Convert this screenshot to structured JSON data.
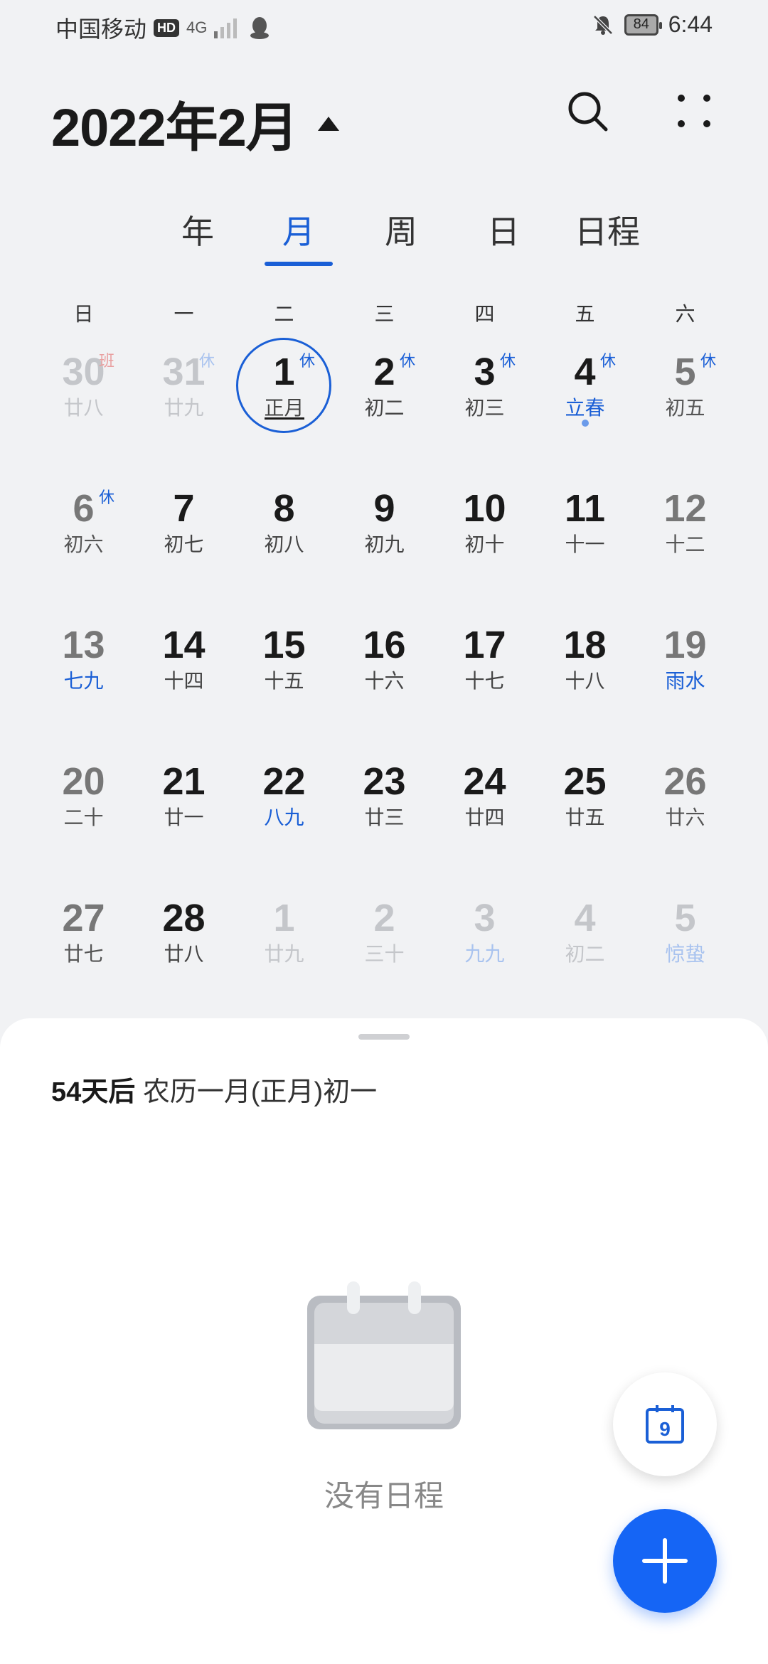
{
  "status_bar": {
    "carrier": "中国移动",
    "hd_badge": "HD",
    "network": "4G",
    "battery_level": "84",
    "time": "6:44"
  },
  "header": {
    "title": "2022年2月",
    "caret_icon": "triangle-up-icon",
    "search_icon": "search-icon",
    "more_icon": "more-dots-icon"
  },
  "tabs": [
    {
      "label": "年"
    },
    {
      "label": "月"
    },
    {
      "label": "周"
    },
    {
      "label": "日"
    },
    {
      "label": "日程"
    }
  ],
  "active_tab": "月",
  "weekdays": [
    "日",
    "一",
    "二",
    "三",
    "四",
    "五",
    "六"
  ],
  "weeks": [
    [
      {
        "day": "30",
        "lunar": "廿八",
        "badge": "班",
        "outside": true
      },
      {
        "day": "31",
        "lunar": "廿九",
        "badge": "休",
        "outside": true
      },
      {
        "day": "1",
        "lunar": "正月",
        "badge": "休",
        "today": true
      },
      {
        "day": "2",
        "lunar": "初二",
        "badge": "休"
      },
      {
        "day": "3",
        "lunar": "初三",
        "badge": "休"
      },
      {
        "day": "4",
        "lunar": "立春",
        "badge": "休",
        "lunar_blue": true,
        "dot": true
      },
      {
        "day": "5",
        "lunar": "初五",
        "badge": "休",
        "weekend": true
      }
    ],
    [
      {
        "day": "6",
        "lunar": "初六",
        "badge": "休",
        "weekend": true
      },
      {
        "day": "7",
        "lunar": "初七"
      },
      {
        "day": "8",
        "lunar": "初八"
      },
      {
        "day": "9",
        "lunar": "初九"
      },
      {
        "day": "10",
        "lunar": "初十"
      },
      {
        "day": "11",
        "lunar": "十一"
      },
      {
        "day": "12",
        "lunar": "十二",
        "weekend": true
      }
    ],
    [
      {
        "day": "13",
        "lunar": "七九",
        "lunar_blue": true,
        "weekend": true
      },
      {
        "day": "14",
        "lunar": "十四"
      },
      {
        "day": "15",
        "lunar": "十五"
      },
      {
        "day": "16",
        "lunar": "十六"
      },
      {
        "day": "17",
        "lunar": "十七"
      },
      {
        "day": "18",
        "lunar": "十八"
      },
      {
        "day": "19",
        "lunar": "雨水",
        "lunar_blue": true,
        "weekend": true
      }
    ],
    [
      {
        "day": "20",
        "lunar": "二十",
        "weekend": true
      },
      {
        "day": "21",
        "lunar": "廿一"
      },
      {
        "day": "22",
        "lunar": "八九",
        "lunar_blue": true
      },
      {
        "day": "23",
        "lunar": "廿三"
      },
      {
        "day": "24",
        "lunar": "廿四"
      },
      {
        "day": "25",
        "lunar": "廿五"
      },
      {
        "day": "26",
        "lunar": "廿六",
        "weekend": true
      }
    ],
    [
      {
        "day": "27",
        "lunar": "廿七",
        "weekend": true
      },
      {
        "day": "28",
        "lunar": "廿八"
      },
      {
        "day": "1",
        "lunar": "廿九",
        "outside": true
      },
      {
        "day": "2",
        "lunar": "三十",
        "outside": true
      },
      {
        "day": "3",
        "lunar": "九九",
        "lunar_blue": true,
        "outside": true
      },
      {
        "day": "4",
        "lunar": "初二",
        "outside": true
      },
      {
        "day": "5",
        "lunar": "惊蛰",
        "lunar_blue": true,
        "outside": true
      }
    ]
  ],
  "sheet": {
    "countdown_prefix": "54天后",
    "countdown_text": "农历一月(正月)初一",
    "empty_text": "没有日程"
  },
  "fab": {
    "today_icon": "calendar-today-icon",
    "today_number": "9",
    "add_icon": "plus-icon"
  },
  "colors": {
    "accent": "#1a5fd6",
    "fab_blue": "#1565f5",
    "background": "#f1f2f4"
  }
}
